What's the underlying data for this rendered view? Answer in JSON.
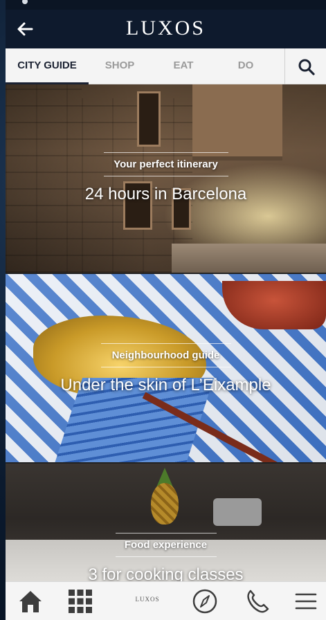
{
  "header": {
    "brand": "LUXOS",
    "back_icon": "arrow-left-icon"
  },
  "tabs": [
    {
      "label": "CITY GUIDE",
      "active": true
    },
    {
      "label": "SHOP",
      "active": false
    },
    {
      "label": "EAT",
      "active": false
    },
    {
      "label": "DO",
      "active": false
    }
  ],
  "search_icon": "search-icon",
  "cards": [
    {
      "kicker": "Your perfect itinerary",
      "headline": "24 hours in Barcelona"
    },
    {
      "kicker": "Neighbourhood guide",
      "headline": "Under the skin of L’Eixample"
    },
    {
      "kicker": "Food experience",
      "headline": "3 for cooking classes"
    }
  ],
  "bottom_nav": {
    "brand": "LUXOS",
    "items": [
      "home-icon",
      "grid-icon",
      "compass-icon",
      "phone-icon",
      "menu-icon"
    ]
  },
  "colors": {
    "header_bg": "#0e1a2d",
    "tab_active": "#1b2232",
    "tab_inactive": "#9a9a9a",
    "nav_icon": "#3d3d3d"
  }
}
